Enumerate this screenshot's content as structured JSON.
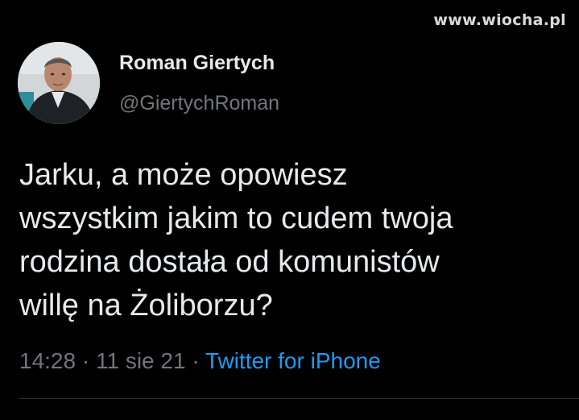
{
  "watermark": "www.wiocha.pl",
  "tweet": {
    "author": {
      "name": "Roman Giertych",
      "handle": "@GiertychRoman"
    },
    "text_lines": [
      "Jarku, a może opowiesz",
      "wszystkim jakim to cudem twoja",
      "rodzina dostała od komunistów",
      "willę na Żoliborzu?"
    ],
    "time": "14:28",
    "separator": "·",
    "date": "11 sie 21",
    "source": "Twitter for iPhone"
  },
  "colors": {
    "background": "#000000",
    "text": "#e7e9ea",
    "secondary": "#71767b",
    "link": "#1d9bf0"
  }
}
